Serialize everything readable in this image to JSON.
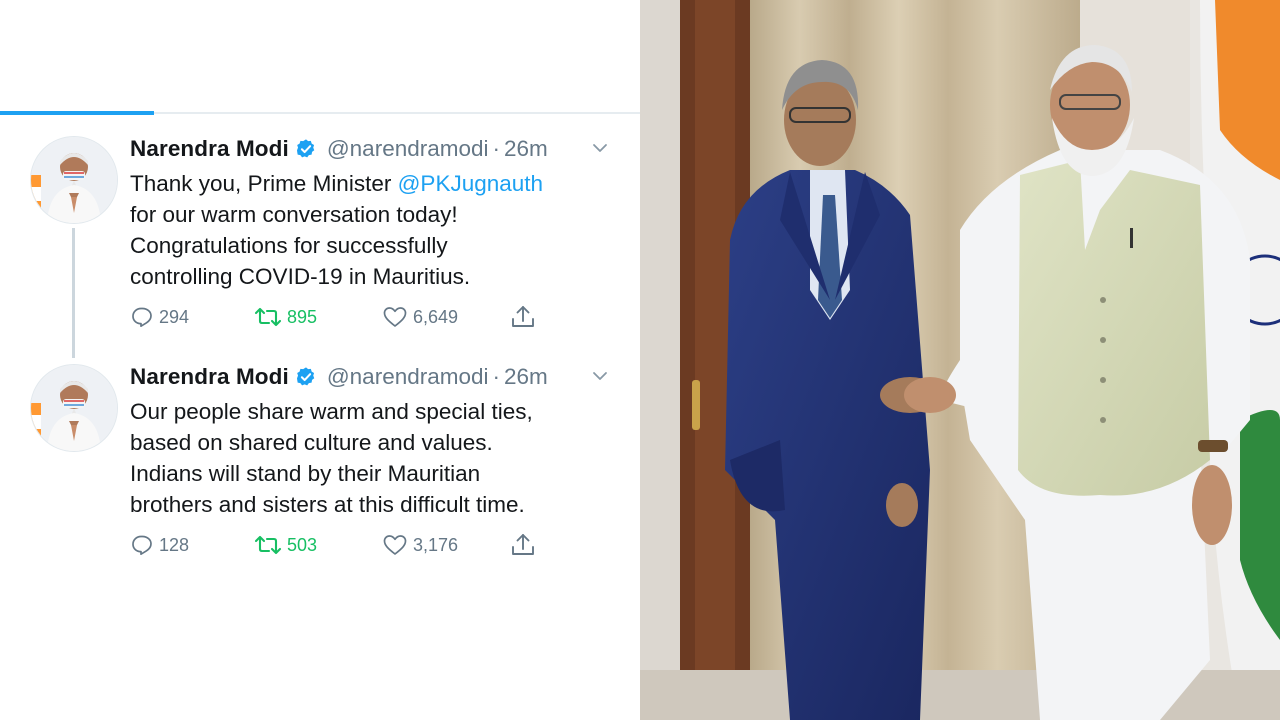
{
  "colors": {
    "accent": "#1da1f2",
    "retweet": "#17bf63",
    "text_primary": "#14171a",
    "text_secondary": "#657786"
  },
  "progress": {
    "fraction": 0.24
  },
  "tweets": [
    {
      "name": "Narendra Modi",
      "handle": "@narendramodi",
      "separator": "·",
      "time": "26m",
      "lines": [
        {
          "before": "Thank you, Prime Minister ",
          "mention": "@PKJugnauth"
        },
        {
          "before": "for our warm conversation today!"
        },
        {
          "before": "Congratulations for successfully"
        },
        {
          "before": "controlling COVID-19 in Mauritius."
        }
      ],
      "replies": "294",
      "retweets": "895",
      "likes": "6,649"
    },
    {
      "name": "Narendra Modi",
      "handle": "@narendramodi",
      "separator": "·",
      "time": "26m",
      "lines": [
        {
          "before": "Our people share warm and special ties,"
        },
        {
          "before": "based on shared culture and values."
        },
        {
          "before": "Indians will stand by their Mauritian"
        },
        {
          "before": "brothers and sisters at this difficult time."
        }
      ],
      "replies": "128",
      "retweets": "503",
      "likes": "3,176"
    }
  ],
  "icons": {
    "verified": "verified-badge-icon",
    "caret": "chevron-down-icon",
    "reply": "reply-bubble-icon",
    "retweet": "retweet-icon",
    "like": "heart-icon",
    "share": "share-upload-icon"
  }
}
